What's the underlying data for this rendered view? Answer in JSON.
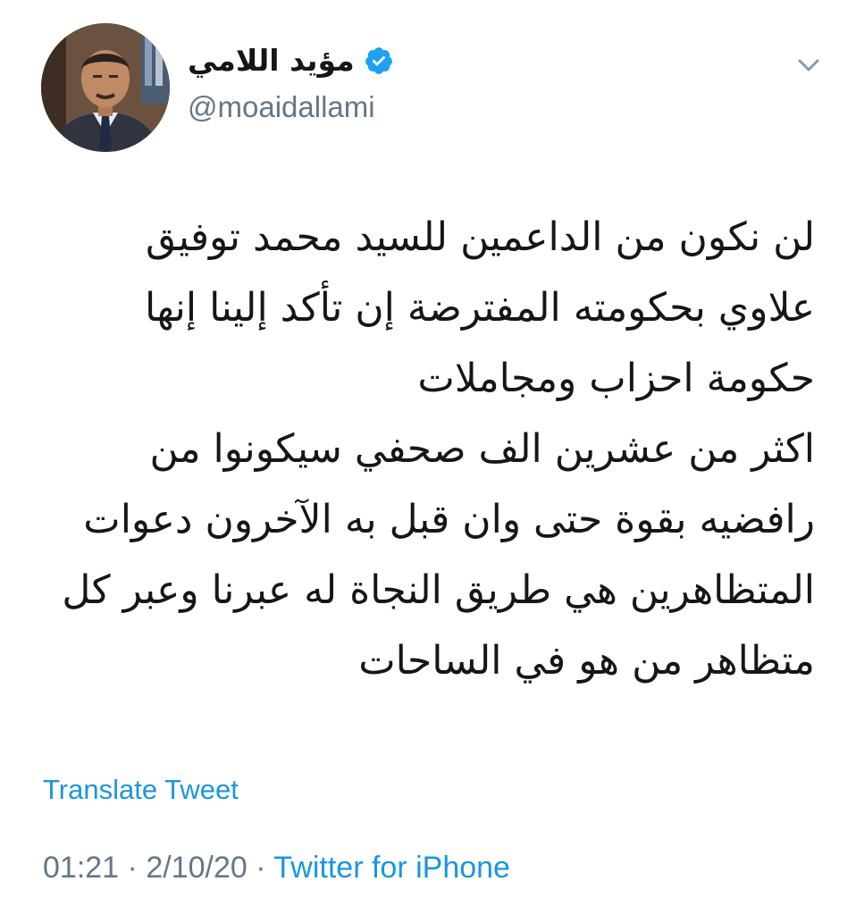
{
  "tweet": {
    "author": {
      "display_name": "مؤيد اللامي",
      "handle": "@moaidallami",
      "verified": true
    },
    "text_lines": [
      "لن نكون من الداعمين للسيد محمد توفيق",
      "علاوي بحكومته المفترضة إن تأكد إلينا إنها",
      "حكومة احزاب  ومجاملات",
      "اكثر من عشرين  الف صحفي سيكونوا من",
      "رافضيه بقوة حتى وان قبل به الآخرون دعوات",
      "المتظاهرين هي طريق النجاة له عبرنا وعبر كل",
      "متظاهر من هو في الساحات"
    ],
    "translate_label": "Translate Tweet",
    "time": "01:21",
    "separator": "·",
    "date": "2/10/20",
    "source": "Twitter for iPhone"
  },
  "icons": {
    "verified": "verified-badge-icon",
    "menu": "chevron-down-icon"
  },
  "colors": {
    "link": "#1b95e0",
    "secondary_text": "#657786",
    "primary_text": "#14171a"
  }
}
